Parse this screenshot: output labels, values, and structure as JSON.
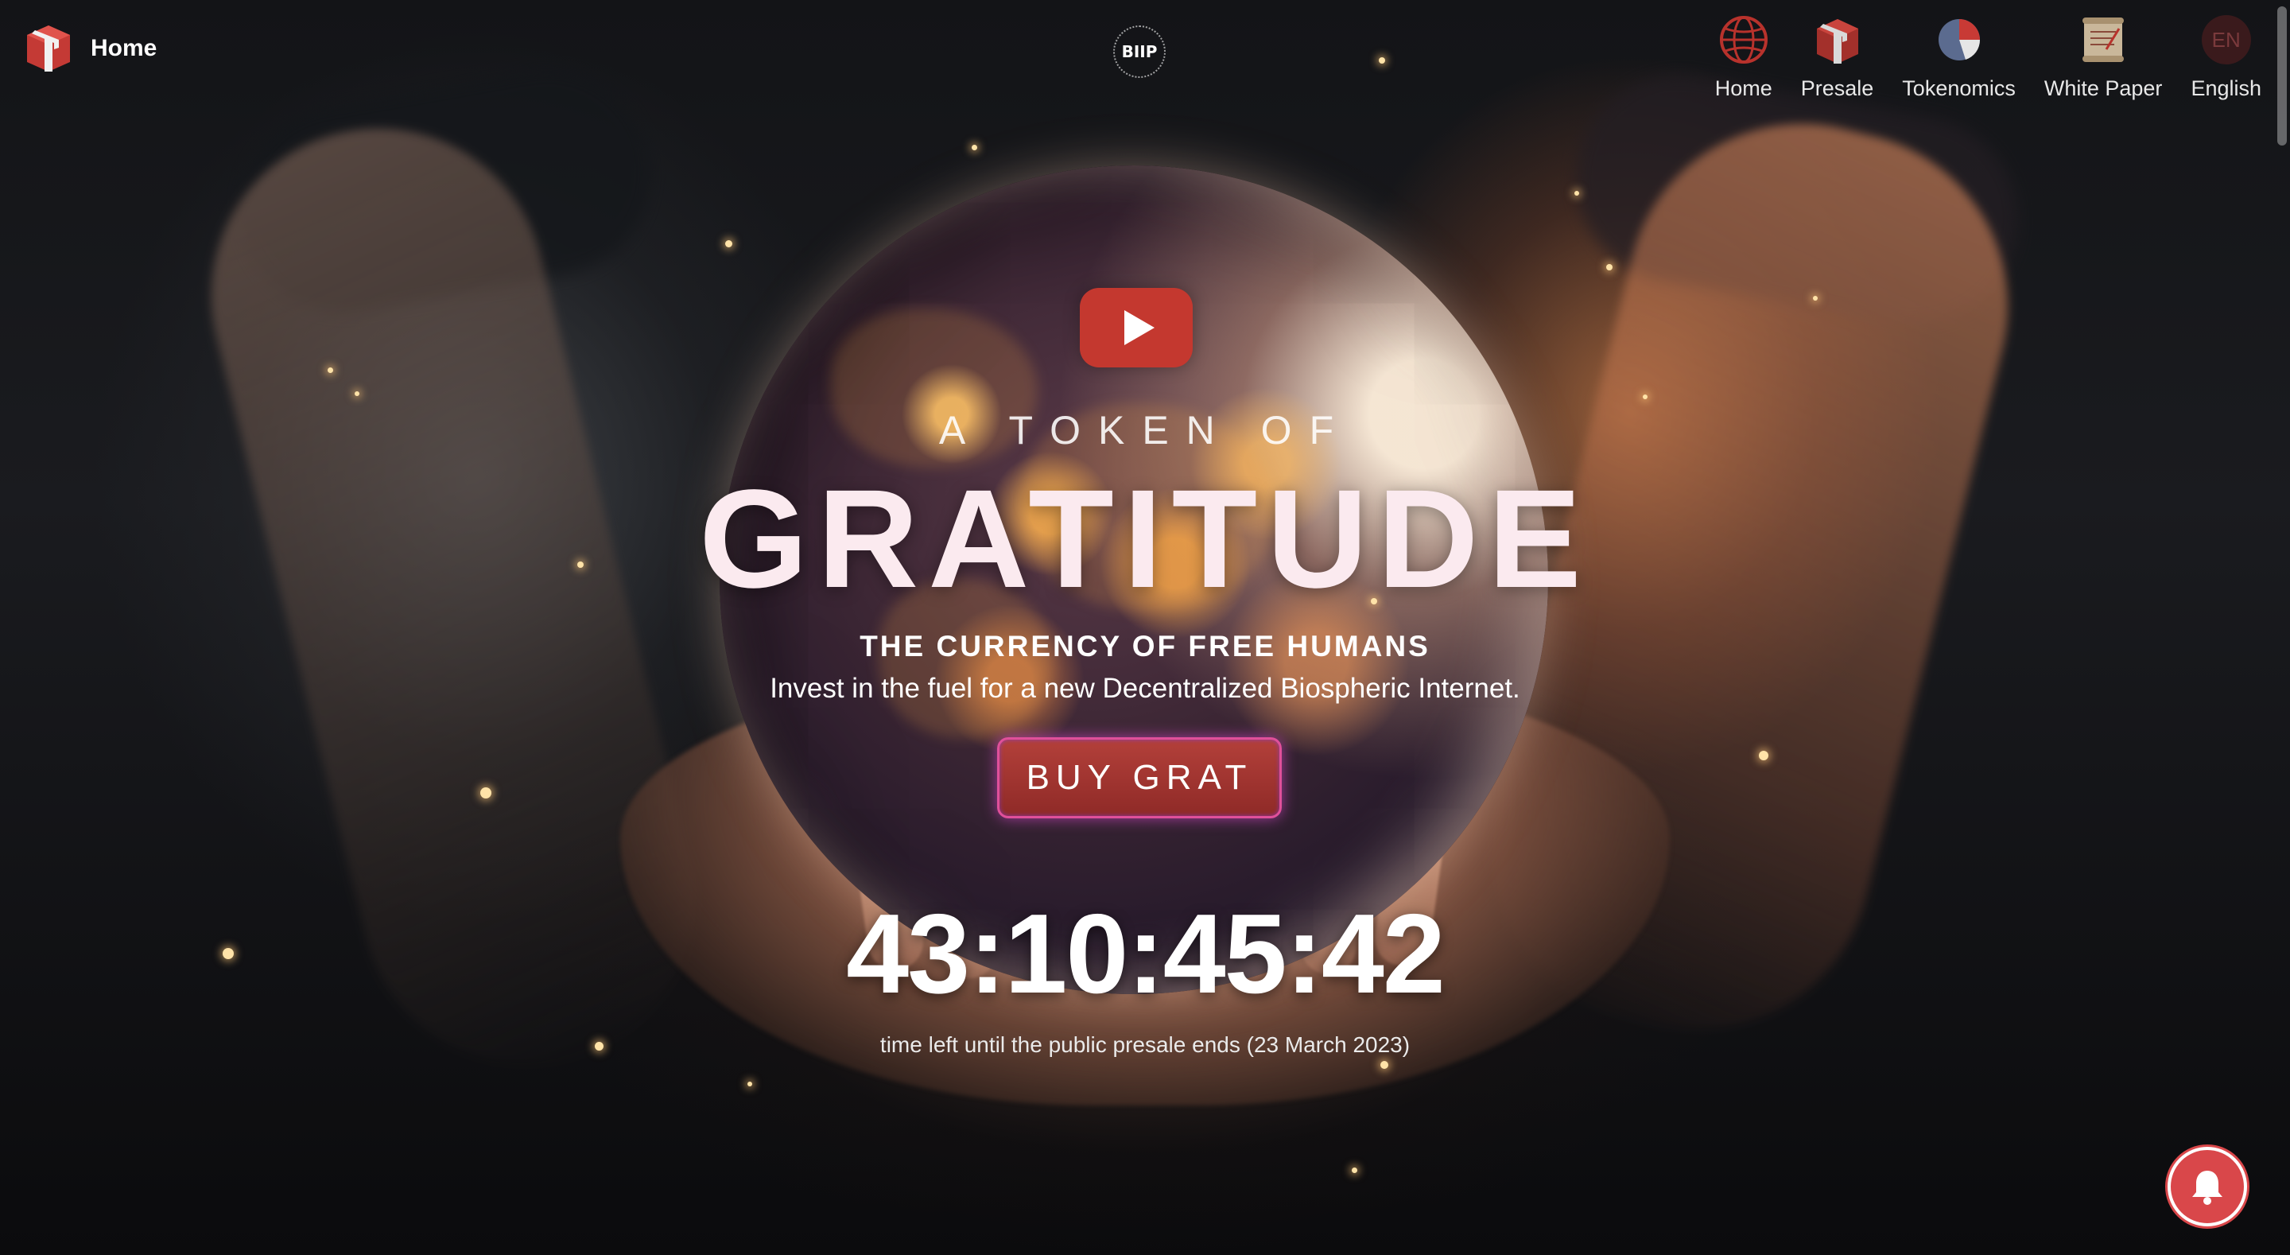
{
  "header": {
    "logo_icon": "gift-box-logo-icon",
    "home_label": "Home",
    "center_badge": "BIIP"
  },
  "nav": {
    "items": [
      {
        "label": "Home",
        "icon": "globe-icon"
      },
      {
        "label": "Presale",
        "icon": "gift-box-icon"
      },
      {
        "label": "Tokenomics",
        "icon": "pie-chart-icon"
      },
      {
        "label": "White Paper",
        "icon": "scroll-icon"
      },
      {
        "label": "English",
        "icon": "language-icon",
        "badge": "EN"
      }
    ]
  },
  "hero": {
    "tagline": "A TOKEN OF",
    "headline": "GRATITUDE",
    "subheadline": "THE CURRENCY OF FREE HUMANS",
    "description": "Invest in the fuel for a new Decentralized Biospheric Internet.",
    "buy_button_label": "BUY GRAT",
    "countdown": "43:10:45:42",
    "countdown_caption": "time left until the public presale ends (23 March 2023)"
  },
  "colors": {
    "accent_red": "#c4382f",
    "button_glow": "#e0509a",
    "bell_red": "#d9474a"
  }
}
